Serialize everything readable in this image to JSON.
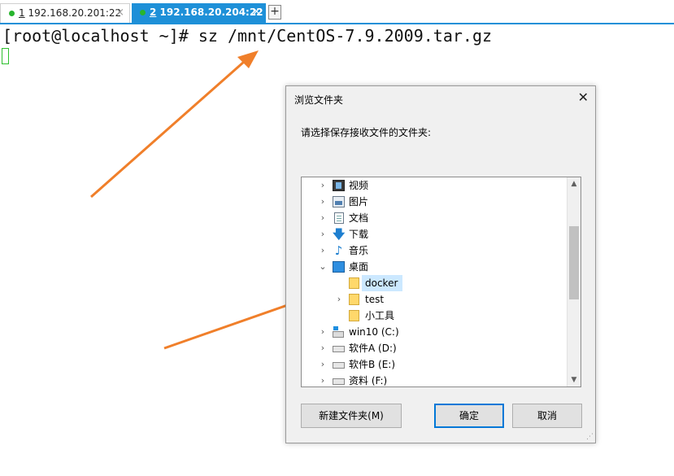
{
  "tabs": [
    {
      "number": "1",
      "label": " 192.168.20.201:22",
      "close": "×"
    },
    {
      "number": "2",
      "label": " 192.168.20.204:22",
      "close": "×"
    }
  ],
  "add_tab": "+",
  "terminal": {
    "command": "[root@localhost ~]# sz /mnt/CentOS-7.9.2009.tar.gz"
  },
  "dialog": {
    "title": "浏览文件夹",
    "close": "✕",
    "prompt": "请选择保存接收文件的文件夹:",
    "tree": [
      {
        "label": "视频",
        "icon": "video-icon",
        "chevron": "›"
      },
      {
        "label": "图片",
        "icon": "pictures-icon",
        "chevron": "›"
      },
      {
        "label": "文档",
        "icon": "documents-icon",
        "chevron": "›"
      },
      {
        "label": "下载",
        "icon": "download-arrow-icon",
        "chevron": "›"
      },
      {
        "label": "音乐",
        "icon": "music-note-icon",
        "chevron": "›"
      },
      {
        "label": "桌面",
        "icon": "desktop-icon",
        "chevron": "⌄"
      },
      {
        "label": "docker",
        "icon": "folder-icon",
        "chevron": ""
      },
      {
        "label": "test",
        "icon": "folder-icon",
        "chevron": "›"
      },
      {
        "label": "小工具",
        "icon": "folder-icon",
        "chevron": ""
      },
      {
        "label": "win10 (C:)",
        "icon": "windows-drive-icon",
        "chevron": "›"
      },
      {
        "label": "软件A (D:)",
        "icon": "drive-icon",
        "chevron": "›"
      },
      {
        "label": "软件B (E:)",
        "icon": "drive-icon",
        "chevron": "›"
      },
      {
        "label": "资料 (F:)",
        "icon": "drive-icon",
        "chevron": "›"
      }
    ],
    "selected": "docker",
    "buttons": {
      "new_folder": "新建文件夹(M)",
      "ok": "确定",
      "cancel": "取消"
    }
  },
  "colors": {
    "tab_active": "#1e90d8",
    "arrow": "#f07f2a",
    "selection": "#cce8ff",
    "ok_border": "#0078d7"
  }
}
